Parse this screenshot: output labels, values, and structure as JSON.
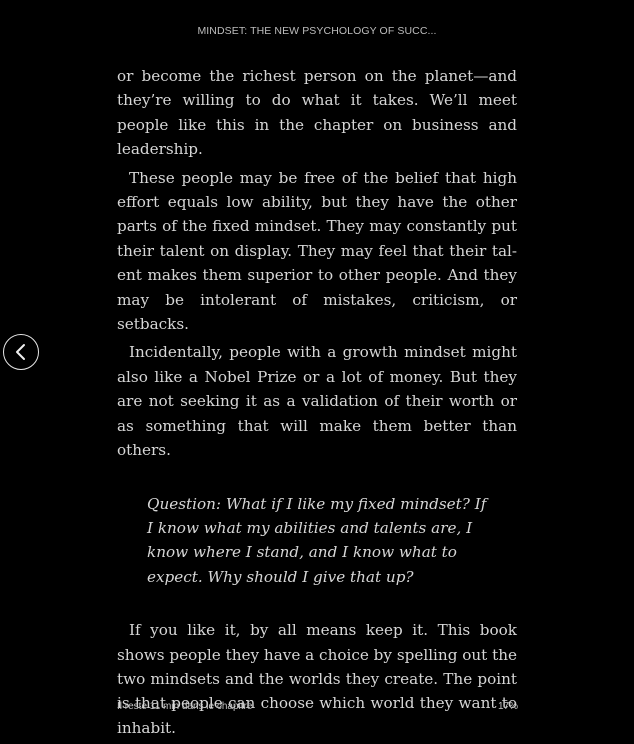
{
  "header": {
    "book_title": "MINDSET: THE NEW PSYCHOLOGY OF SUCC..."
  },
  "content": {
    "paragraphs": [
      "or become the richest person on the planet—and they’re willing to do what it takes. We’ll meet people like this in the chapter on business and leadership.",
      "These people may be free of the belief that high effort equals low ability, but they have the other parts of the fixed mindset. They may constantly put their talent on display. They may feel that their tal­ent makes them superior to other people. And they may be intolerant of mistakes, criticism, or setbacks.",
      "Incidentally, people with a growth mindset might also like a Nobel Prize or a lot of money. But they are not seeking it as a validation of their worth or as something that will make them better than others.",
      "Question: What if I like my fixed mindset? If I know what my abilities and talents are, I know where I stand, and I know what to expect. Why should I give that up?",
      "If you like it, by all means keep it. This book shows people they have a choice by spelling out the two mindsets and the worlds they create. The point is that people can choose which world they want to inhabit."
    ]
  },
  "navigation": {
    "prev_icon": "chevron-left-icon"
  },
  "footer": {
    "time_left": "Il reste 11 min dans le chapitre",
    "progress": "17%"
  },
  "colors": {
    "background": "#000000",
    "text": "#d6d6d6"
  }
}
